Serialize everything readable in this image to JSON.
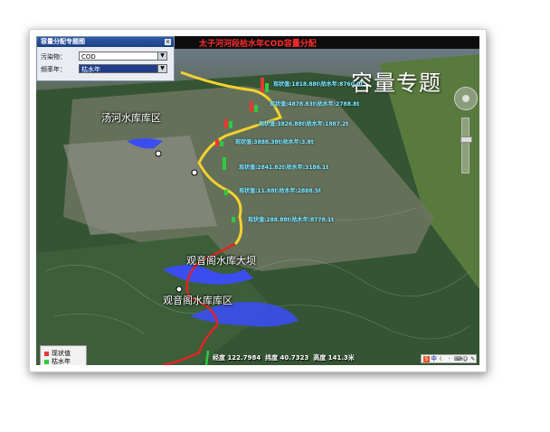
{
  "window": {
    "title": "容量分配专题图"
  },
  "panel": {
    "pollutant_label": "污染物：",
    "pollutant_value": "COD",
    "frequency_label": "频率年：",
    "frequency_value": "枯水年"
  },
  "map": {
    "title": "太子河河段枯水年COD容量分配",
    "overlay_title": "容量专题",
    "places": {
      "tanghe": "汤河水库库区",
      "guanyinge_dam": "观音阁水库大坝",
      "guanyinge_reservoir": "观音阁水库库区"
    },
    "labels": [
      "现状值:1818.88t\\枯水年:8760.0t",
      "现状值:4878.83t\\枯水年:2788.8t",
      "现状值:3826.88t\\枯水年:1887.2t",
      "现状值:3888.38t\\枯水年:3.8t",
      "现状值:2841.82t\\枯水年:3186.1t",
      "现状值:11.88t\\枯水年:2888.5t",
      "现状值:288.88t\\枯水年:8778.1t"
    ]
  },
  "legend": {
    "current": "现状值",
    "dry_year": "枯水年"
  },
  "status": {
    "lon_label": "经度",
    "lon": "122.7984",
    "lat_label": "纬度",
    "lat": "40.7323",
    "alt_label": "高度",
    "alt": "141.3米"
  },
  "tray": {
    "lang": "中"
  },
  "colors": {
    "current": "#e53935",
    "dry_year": "#2ecc40",
    "river_upper": "#f2d22e",
    "river_lower": "#e02424",
    "reservoir": "#3a4ef0"
  }
}
